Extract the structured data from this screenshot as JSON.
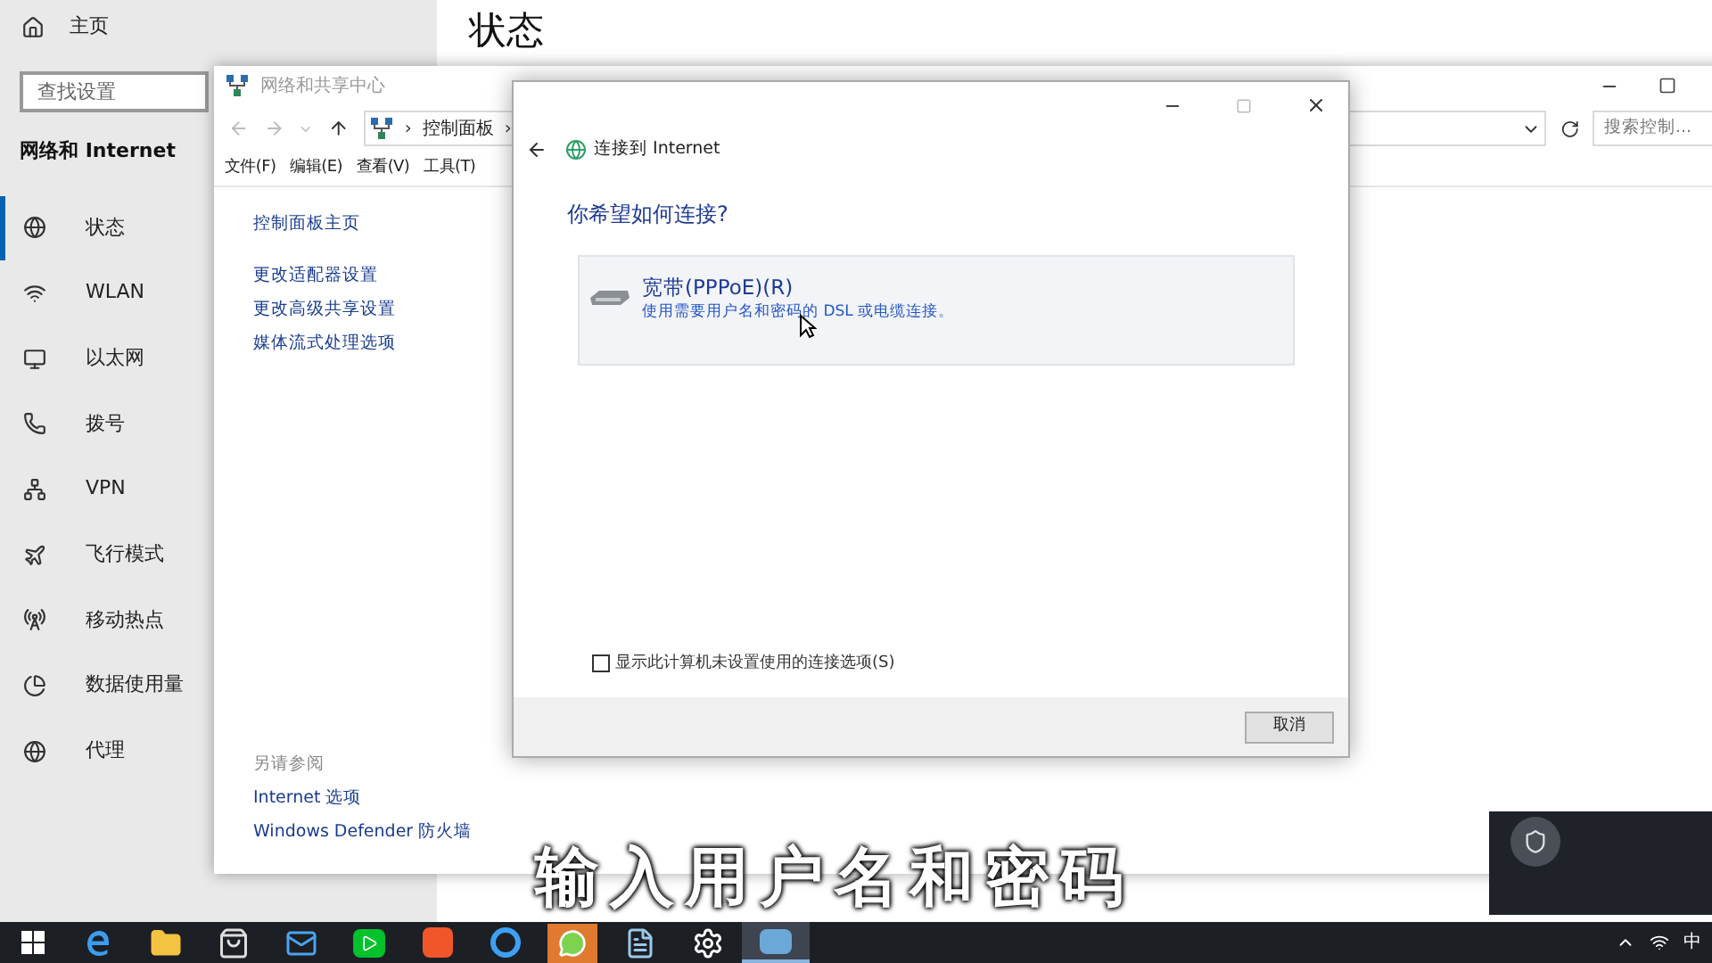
{
  "settings": {
    "home": "主页",
    "search_placeholder": "查找设置",
    "section": "网络和 Internet",
    "page_title": "状态",
    "nav": [
      {
        "label": "状态",
        "kind": "status",
        "selected": true
      },
      {
        "label": "WLAN",
        "kind": "wifi",
        "selected": false
      },
      {
        "label": "以太网",
        "kind": "ethernet",
        "selected": false
      },
      {
        "label": "拨号",
        "kind": "dialup",
        "selected": false
      },
      {
        "label": "VPN",
        "kind": "vpn",
        "selected": false
      },
      {
        "label": "飞行模式",
        "kind": "plane",
        "selected": false
      },
      {
        "label": "移动热点",
        "kind": "hotspot",
        "selected": false
      },
      {
        "label": "数据使用量",
        "kind": "data",
        "selected": false
      },
      {
        "label": "代理",
        "kind": "proxy",
        "selected": false
      }
    ]
  },
  "control_panel": {
    "title": "网络和共享中心",
    "address": [
      {
        "kind": "separator",
        "text": "›"
      },
      {
        "kind": "crumb",
        "text": "控制面板"
      },
      {
        "kind": "separator",
        "text": "›"
      }
    ],
    "search_placeholder": "搜索控制...",
    "menu": [
      "文件(F)",
      "编辑(E)",
      "查看(V)",
      "工具(T)"
    ],
    "links": [
      "控制面板主页",
      "更改适配器设置",
      "更改高级共享设置",
      "媒体流式处理选项"
    ],
    "see_also_title": "另请参阅",
    "see_also": [
      "Internet 选项",
      "Windows Defender 防火墙"
    ]
  },
  "dialog": {
    "title": "连接到 Internet",
    "heading": "你希望如何连接?",
    "options": [
      {
        "title": "宽带(PPPoE)(R)",
        "description": "使用需要用户名和密码的 DSL 或电缆连接。",
        "selected": true
      }
    ],
    "show_all": {
      "label": "显示此计算机未设置使用的连接选项(S)",
      "checked": false
    },
    "cancel": "取消"
  },
  "caption": "输入用户名和密码",
  "taskbar": {
    "apps": [
      {
        "kind": "edge",
        "active": false
      },
      {
        "kind": "explorer",
        "active": false
      },
      {
        "kind": "store",
        "active": false
      },
      {
        "kind": "mail",
        "active": false
      },
      {
        "kind": "video",
        "active": false
      },
      {
        "kind": "input",
        "active": false
      },
      {
        "kind": "browser",
        "active": false
      },
      {
        "kind": "chat",
        "active": false
      },
      {
        "kind": "notepad",
        "active": false
      },
      {
        "kind": "settings",
        "active": false
      },
      {
        "kind": "network",
        "active": true
      }
    ],
    "ime": "中"
  }
}
